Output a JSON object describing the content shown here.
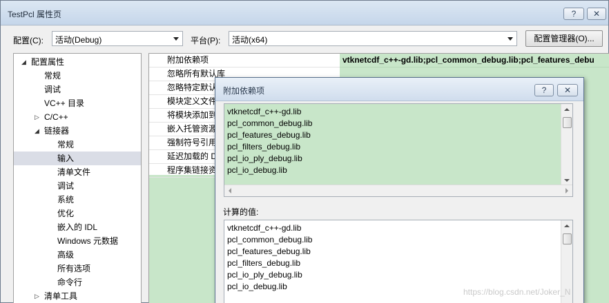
{
  "window": {
    "title": "TestPcl 属性页",
    "help_label": "?",
    "close_label": "✕"
  },
  "toolbar": {
    "config_label": "配置(C):",
    "config_value": "活动(Debug)",
    "platform_label": "平台(P):",
    "platform_value": "活动(x64)",
    "config_manager_label": "配置管理器(O)..."
  },
  "tree": {
    "items": [
      {
        "label": "配置属性",
        "expander": "◢"
      },
      {
        "label": "常规"
      },
      {
        "label": "调试"
      },
      {
        "label": "VC++ 目录"
      },
      {
        "label": "C/C++",
        "expander": "▷"
      },
      {
        "label": "链接器",
        "expander": "◢"
      },
      {
        "label": "常规"
      },
      {
        "label": "输入"
      },
      {
        "label": "清单文件"
      },
      {
        "label": "调试"
      },
      {
        "label": "系统"
      },
      {
        "label": "优化"
      },
      {
        "label": "嵌入的 IDL"
      },
      {
        "label": "Windows 元数据"
      },
      {
        "label": "高级"
      },
      {
        "label": "所有选项"
      },
      {
        "label": "命令行"
      },
      {
        "label": "清单工具",
        "expander": "▷"
      }
    ]
  },
  "properties": {
    "rows": [
      {
        "name": "附加依赖项",
        "value": "vtknetcdf_c++-gd.lib;pcl_common_debug.lib;pcl_features_debu"
      },
      {
        "name": "忽略所有默认库"
      },
      {
        "name": "忽略特定默认库"
      },
      {
        "name": "模块定义文件"
      },
      {
        "name": "将模块添加到"
      },
      {
        "name": "嵌入托管资源"
      },
      {
        "name": "强制符号引用"
      },
      {
        "name": "延迟加载的 D"
      },
      {
        "name": "程序集链接资"
      }
    ]
  },
  "dialog": {
    "title": "附加依赖项",
    "help_label": "?",
    "close_label": "✕",
    "input_lines": [
      "vtknetcdf_c++-gd.lib",
      "pcl_common_debug.lib",
      "pcl_features_debug.lib",
      "pcl_filters_debug.lib",
      "pcl_io_ply_debug.lib",
      "pcl_io_debug.lib"
    ],
    "computed_label": "计算的值:",
    "computed_lines": [
      "vtknetcdf_c++-gd.lib",
      "pcl_common_debug.lib",
      "pcl_features_debug.lib",
      "pcl_filters_debug.lib",
      "pcl_io_ply_debug.lib",
      "pcl_io_debug.lib"
    ]
  },
  "watermark": "https://blog.csdn.net/Joker_N"
}
